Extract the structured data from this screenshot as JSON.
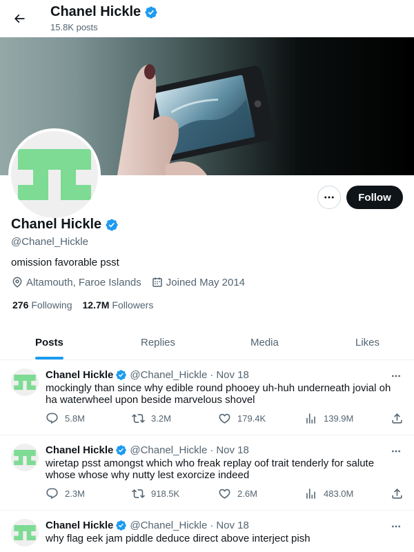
{
  "header": {
    "title": "Chanel Hickle",
    "posts_count": "15.8K posts",
    "back_icon": "arrow-left-icon"
  },
  "profile": {
    "name": "Chanel Hickle",
    "handle": "@Chanel_Hickle",
    "bio": "omission favorable psst",
    "location": "Altamouth, Faroe Islands",
    "joined": "Joined May 2014",
    "following_count": "276",
    "following_label": "Following",
    "followers_count": "12.7M",
    "followers_label": "Followers",
    "follow_label": "Follow",
    "avatar_color": "#7ddb94",
    "verified_color": "#1d9bf0"
  },
  "tabs": [
    {
      "label": "Posts",
      "active": true
    },
    {
      "label": "Replies",
      "active": false
    },
    {
      "label": "Media",
      "active": false
    },
    {
      "label": "Likes",
      "active": false
    }
  ],
  "posts": [
    {
      "name": "Chanel Hickle",
      "handle": "@Chanel_Hickle",
      "date": "Nov 18",
      "text": "mockingly than since why edible round phooey uh-huh underneath jovial oh ha waterwheel upon beside marvelous shovel",
      "replies": "5.8M",
      "reposts": "3.2M",
      "likes": "179.4K",
      "views": "139.9M"
    },
    {
      "name": "Chanel Hickle",
      "handle": "@Chanel_Hickle",
      "date": "Nov 18",
      "text": "wiretap psst amongst which who freak replay oof trait tenderly for salute whose whose why nutty lest exorcize indeed",
      "replies": "2.3M",
      "reposts": "918.5K",
      "likes": "2.6M",
      "views": "483.0M"
    },
    {
      "name": "Chanel Hickle",
      "handle": "@Chanel_Hickle",
      "date": "Nov 18",
      "text": "why flag eek jam piddle deduce direct above interject pish"
    }
  ]
}
